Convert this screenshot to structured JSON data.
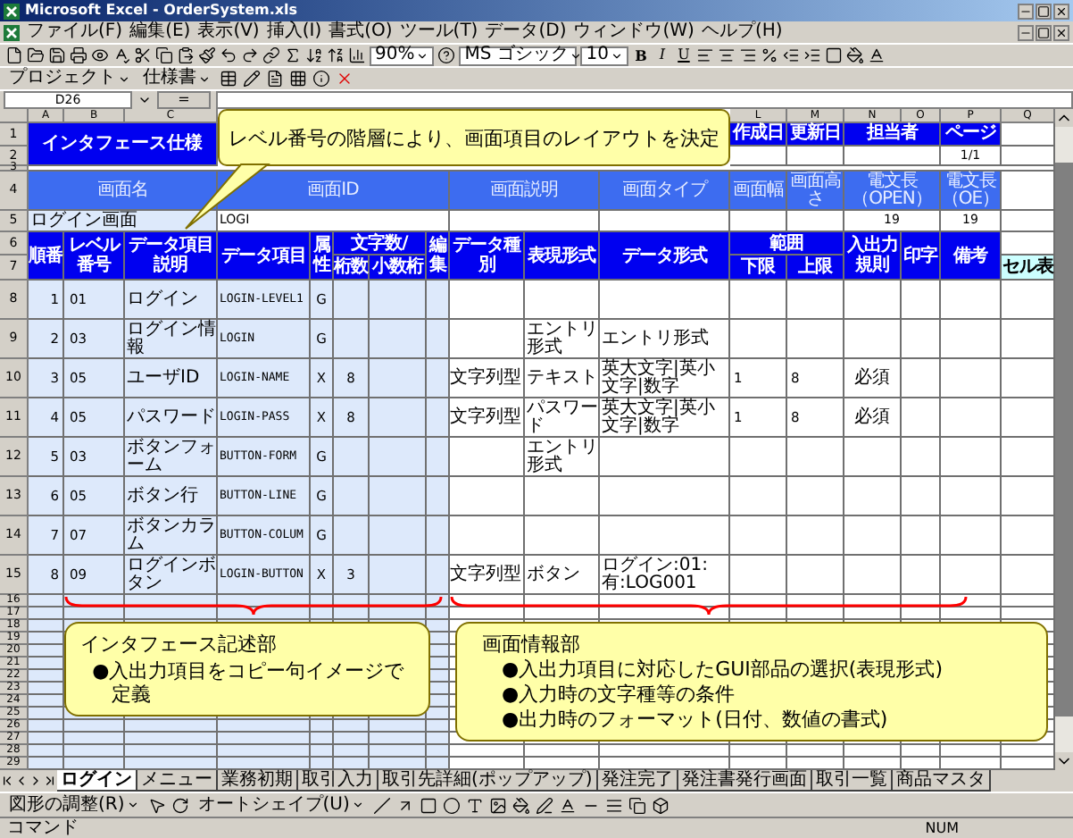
{
  "window": {
    "title": "Microsoft Excel - OrderSystem.xls"
  },
  "menu": [
    "ファイル(F)",
    "編集(E)",
    "表示(V)",
    "挿入(I)",
    "書式(O)",
    "ツール(T)",
    "データ(D)",
    "ウィンドウ(W)",
    "ヘルプ(H)"
  ],
  "toolbar": {
    "zoom": "90%",
    "font": "MS ゴシック",
    "font_size": "10",
    "format_buttons": [
      "B",
      "I",
      "U"
    ]
  },
  "custom_toolbar": {
    "menus": [
      "プロジェクト",
      "仕様書"
    ]
  },
  "formula_bar": {
    "name_box": "D26",
    "equals": "="
  },
  "sheet": {
    "column_headers": {
      "left": [
        "A",
        "B",
        "C"
      ],
      "right": [
        "L",
        "M",
        "N",
        "O",
        "P",
        "Q"
      ]
    },
    "row_numbers": [
      "1",
      "2",
      "3",
      "4",
      "5",
      "6",
      "7",
      "8",
      "9",
      "10",
      "11",
      "12",
      "13",
      "14",
      "15",
      "16",
      "17",
      "18",
      "19",
      "20",
      "21",
      "22",
      "23",
      "24",
      "25",
      "26",
      "27",
      "28",
      "29"
    ],
    "title": "インタフェース仕様",
    "meta_labels": [
      "作成日",
      "更新日",
      "担当者",
      "ページ"
    ],
    "page": "1/1",
    "screen_labels": [
      "画面名",
      "画面ID",
      "画面説明",
      "画面タイプ",
      "画面幅",
      "画面高さ",
      "電文長（OPEN）",
      "電文長（OE）"
    ],
    "screen_values": {
      "name": "ログイン画面",
      "id": "LOGI",
      "open_length": "19",
      "oe_length": "19"
    },
    "header_top": [
      "順番",
      "レベル番号",
      "データ項目説明",
      "データ項目",
      "属性",
      "文字数/",
      "編集",
      "データ種別",
      "表現形式",
      "データ形式",
      "範囲",
      "入出力規則",
      "印字",
      "備考"
    ],
    "header_bottom": [
      "桁数",
      "小数桁",
      "下限",
      "上限",
      "セル表"
    ],
    "rows": [
      {
        "no": "1",
        "level": "01",
        "description": "ログイン",
        "item": "LOGIN-LEVEL1",
        "attribute": "G"
      },
      {
        "no": "2",
        "level": "03",
        "description": "ログイン情報",
        "item": "LOGIN",
        "attribute": "G",
        "presentation": "エントリ形式",
        "data_format": "エントリ形式"
      },
      {
        "no": "3",
        "level": "05",
        "description": "ユーザID",
        "item": "LOGIN-NAME",
        "attribute": "X",
        "length": "8",
        "data_type": "文字列型",
        "presentation": "テキスト",
        "data_format": "英大文字|英小文字|数字",
        "min": "1",
        "max": "8",
        "io_rule": "必須"
      },
      {
        "no": "4",
        "level": "05",
        "description": "パスワード",
        "item": "LOGIN-PASS",
        "attribute": "X",
        "length": "8",
        "data_type": "文字列型",
        "presentation": "パスワード",
        "data_format": "英大文字|英小文字|数字",
        "min": "1",
        "max": "8",
        "io_rule": "必須"
      },
      {
        "no": "5",
        "level": "03",
        "description": "ボタンフォーム",
        "item": "BUTTON-FORM",
        "attribute": "G",
        "presentation": "エントリ形式"
      },
      {
        "no": "6",
        "level": "05",
        "description": "ボタン行",
        "item": "BUTTON-LINE",
        "attribute": "G"
      },
      {
        "no": "7",
        "level": "07",
        "description": "ボタンカラム",
        "item": "BUTTON-COLUM",
        "attribute": "G"
      },
      {
        "no": "8",
        "level": "09",
        "description": "ログインボタン",
        "item": "LOGIN-BUTTON",
        "attribute": "X",
        "length": "3",
        "data_type": "文字列型",
        "presentation": "ボタン",
        "data_format": "ログイン:01:有:LOG001"
      }
    ]
  },
  "callouts": {
    "top": "レベル番号の階層により、画面項目のレイアウトを決定",
    "left": {
      "title": "インタフェース記述部",
      "bullets": [
        "●入出力項目をコピー句イメージで定義"
      ]
    },
    "right": {
      "title": "画面情報部",
      "bullets": [
        "●入出力項目に対応したGUI部品の選択(表現形式)",
        "●入力時の文字種等の条件",
        "●出力時のフォーマット(日付、数値の書式)"
      ]
    }
  },
  "sheet_tabs": [
    {
      "label": "ログイン",
      "selected": true
    },
    {
      "label": "メニュー",
      "selected": false
    },
    {
      "label": "業務初期",
      "selected": false
    },
    {
      "label": "取引入力",
      "selected": false
    },
    {
      "label": "取引先詳細(ポップアップ)",
      "selected": false
    },
    {
      "label": "発注完了",
      "selected": false
    },
    {
      "label": "発注書発行画面",
      "selected": false
    },
    {
      "label": "取引一覧",
      "selected": false
    },
    {
      "label": "商品マスタ",
      "selected": false
    }
  ],
  "drawing_toolbar": {
    "menus": [
      "図形の調整(R)",
      "オートシェイプ(U)"
    ]
  },
  "status_bar": {
    "mode": "コマンド",
    "indicator": "NUM"
  }
}
